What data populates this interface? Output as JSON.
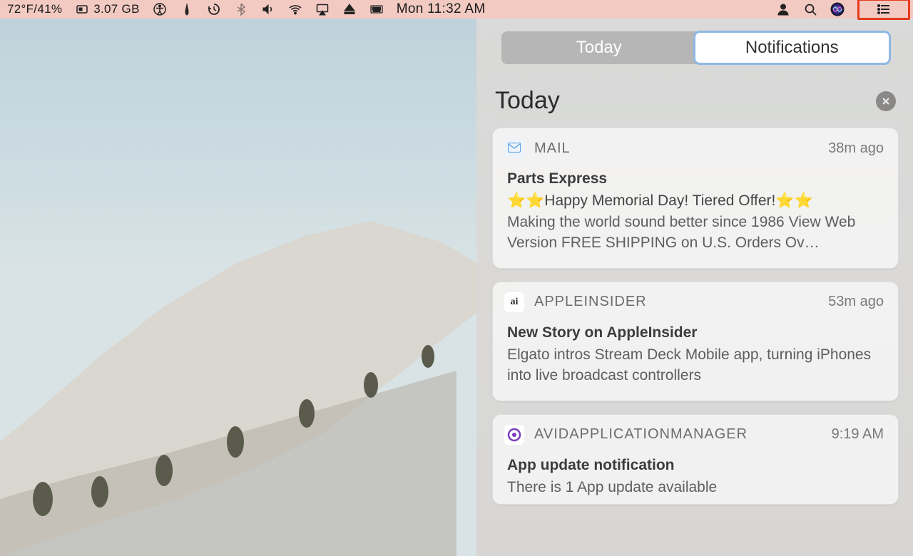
{
  "menubar": {
    "weather": "72°F/41%",
    "memory": "3.07 GB",
    "datetime": "Mon 11:32 AM"
  },
  "nc": {
    "tabs": {
      "today": "Today",
      "notifications": "Notifications"
    },
    "section_title": "Today",
    "cards": [
      {
        "app": "MAIL",
        "time": "38m ago",
        "title": "Parts Express",
        "line1": "⭐⭐Happy Memorial Day! Tiered Offer!⭐⭐",
        "preview": "Making the world sound better since 1986 View Web Version FREE SHIPPING on U.S. Orders Ov…"
      },
      {
        "app": "APPLEINSIDER",
        "time": "53m ago",
        "title": "New Story on AppleInsider",
        "preview": "Elgato intros Stream Deck Mobile app, turning iPhones into live broadcast controllers"
      },
      {
        "app": "AVIDAPPLICATIONMANAGER",
        "time": "9:19 AM",
        "title": "App update notification",
        "preview": "There is 1 App update available"
      }
    ]
  }
}
